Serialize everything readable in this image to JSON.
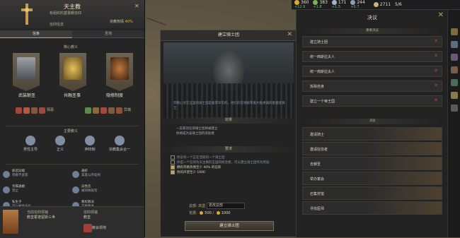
{
  "topbar": {
    "resources": [
      {
        "value": "360",
        "delta": "+12.9",
        "color": "#d7aa38",
        "icon": "gold-coin-icon"
      },
      {
        "value": "383",
        "delta": "+1.8",
        "color": "#7fb04e",
        "icon": "prestige-icon"
      },
      {
        "value": "171",
        "delta": "+1.5",
        "color": "#a0b4c9",
        "icon": "piety-icon"
      },
      {
        "value": "244",
        "delta": "+0.7",
        "color": "#8aa0b8",
        "icon": "renown-icon"
      },
      {
        "value": "2711",
        "delta": "",
        "color": "#cbb27a",
        "icon": "date-icon"
      }
    ],
    "speed": "5/6"
  },
  "faith": {
    "title": "天主教",
    "subtitle": "有组织的基督教信仰",
    "fervor_label": "宗教热情",
    "fervor_value": "40%",
    "view_more": "信仰信息",
    "tabs": [
      "信条",
      "圣地"
    ],
    "core_tenets_title": "核心教义",
    "core_tenets": [
      "武装朝圣",
      "共融圣事",
      "隐修制度"
    ],
    "tolerance_labels": [
      "邪恶",
      "异端"
    ],
    "main_dogma_title": "主要教义",
    "dogmas": [
      "男性主导",
      "正义",
      "神权制",
      "宗教集会合一"
    ],
    "tenet_list": [
      {
        "head": "邪恶异端",
        "text": "宗教不宽容"
      },
      {
        "head": "通奸",
        "text": "高度公开处刑"
      },
      {
        "head": "亲属通婚",
        "text": "禁止"
      },
      {
        "head": "异性恋",
        "text": "被同样处罚"
      },
      {
        "head": "私生子",
        "text": "可以被合法化"
      },
      {
        "head": "教权教派",
        "text": "交易教务"
      }
    ],
    "footer": {
      "head_label": "当前信仰领袖",
      "head_name": "教皇霍诺留斯三世",
      "seat_label": "信仰领袖",
      "seat_value": "教皇",
      "seat2": "教会领地"
    }
  },
  "modal": {
    "title": "建立骑士团",
    "description": "宗教心灵在这里的骑士团是极其罕见的，他们的首领统率着大批虔诚的基督徒骑士",
    "effects_title": "效果",
    "effects": [
      "一支新的信仰骑士团将被建立",
      "你将成为该骑士团的资助者"
    ],
    "requirements_title": "要求",
    "requirements": [
      {
        "text": "你没有一个正在活跃的一个骑士团",
        "ok": false
      },
      {
        "text": "你是一个信仰为天主教的王国的统治者，可以建立骑士团作为奖励",
        "ok": false
      },
      {
        "text": "拥有宗教热情至少 40% 的信仰",
        "ok": true
      },
      {
        "text": "你的声望至少 1000",
        "ok": true
      }
    ],
    "button": "建立骑士团",
    "cost_label": "总部:",
    "cost_hq": "高堡",
    "hq_field": "更改总部",
    "price_label": "花费:",
    "price_have": "500",
    "price_need": "1000"
  },
  "decisions": {
    "title": "决议",
    "pinned_title": "重要决议",
    "pinned": [
      "建立骑士团",
      "统一西斯拉夫人",
      "统一南斯拉夫人",
      "拆除自身",
      "建立一个帝王国"
    ],
    "list_title": "决议",
    "items": [
      "邀请骑士",
      "邀请狂信者",
      "去朝圣",
      "举办宴会",
      "召集狩猎",
      "寻找医师"
    ]
  }
}
